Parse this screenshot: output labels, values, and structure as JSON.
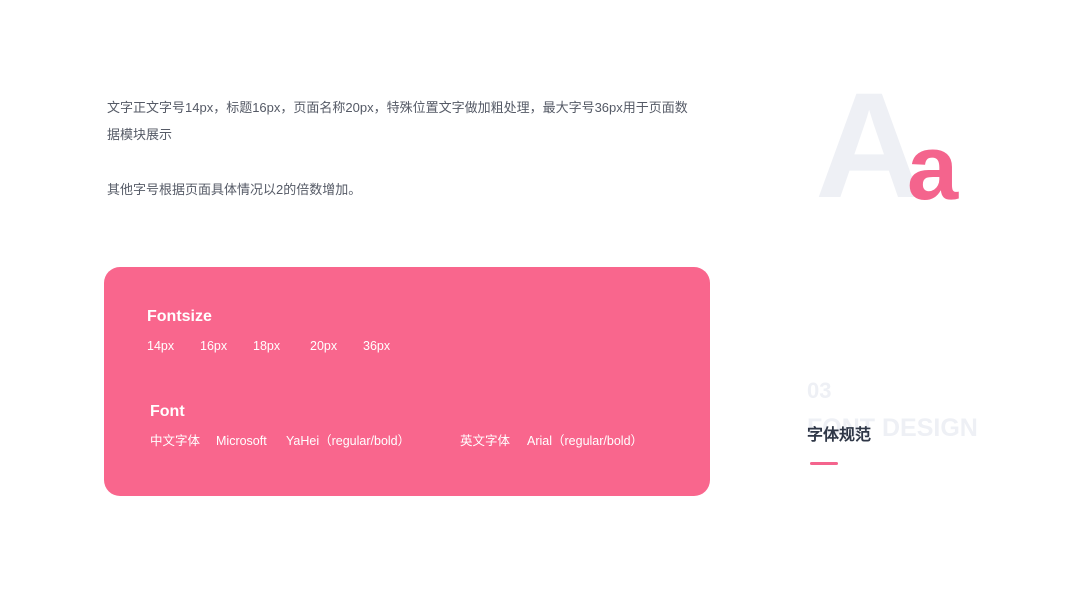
{
  "intro": {
    "line1": "文字正文字号14px，标题16px，页面名称20px，特殊位置文字做加粗处理，最大字号36px用于页面数",
    "line2": "据模块展示",
    "para2": "其他字号根据页面具体情况以2的倍数增加。"
  },
  "hero": {
    "big_letter": "A",
    "small_letter": "a",
    "big_color": "#eef0f5",
    "small_color": "#f4648d"
  },
  "card": {
    "background": "#f9668d",
    "fontsize_title": "Fontsize",
    "sizes": [
      "14px",
      "16px",
      "18px",
      "20px",
      "36px"
    ],
    "font_title": "Font",
    "cn_label": "中文字体",
    "cn_font": "Microsoft",
    "cn_font2": "YaHei（regular/bold）",
    "en_label": "英文字体",
    "en_font": "Arial（regular/bold）"
  },
  "section": {
    "number": "03",
    "title_en": "FONT DESIGN",
    "title_cn": "字体规范",
    "accent": "#f4648d"
  }
}
